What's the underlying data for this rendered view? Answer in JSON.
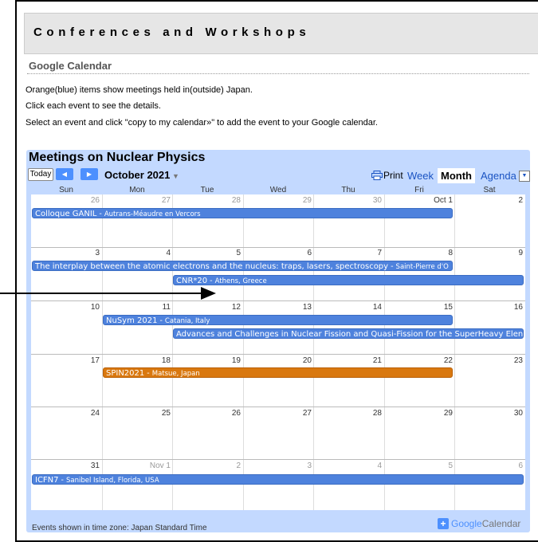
{
  "page": {
    "title": "Conferences and Workshops",
    "section_title": "Google Calendar",
    "info_lines": [
      "Orange(blue) items show meetings held in(outside) Japan.",
      "Click each event to see the details.",
      "Select an event and click \"copy to my calendar»\" to add the event to your Google calendar."
    ]
  },
  "calendar": {
    "title": "Meetings on Nuclear Physics",
    "today_label": "Today",
    "month_label": "October 2021",
    "print_label": "Print",
    "views": [
      "Week",
      "Month",
      "Agenda"
    ],
    "active_view": "Month",
    "weekdays": [
      "Sun",
      "Mon",
      "Tue",
      "Wed",
      "Thu",
      "Fri",
      "Sat"
    ],
    "weeks": [
      [
        "26",
        "27",
        "28",
        "29",
        "30",
        "Oct 1",
        "2"
      ],
      [
        "3",
        "4",
        "5",
        "6",
        "7",
        "8",
        "9"
      ],
      [
        "10",
        "11",
        "12",
        "13",
        "14",
        "15",
        "16"
      ],
      [
        "17",
        "18",
        "19",
        "20",
        "21",
        "22",
        "23"
      ],
      [
        "24",
        "25",
        "26",
        "27",
        "28",
        "29",
        "30"
      ],
      [
        "31",
        "Nov 1",
        "2",
        "3",
        "4",
        "5",
        "6"
      ]
    ],
    "events": [
      {
        "name": "Colloque GANIL",
        "location": "Autrans-Méaudre en Vercors",
        "color": "blue"
      },
      {
        "name": "The interplay between the atomic electrons and the nucleus: traps, lasers, spectroscopy",
        "location": "Saint-Pierre d'O",
        "color": "blue"
      },
      {
        "name": "CNR*20",
        "location": "Athens, Greece",
        "color": "blue"
      },
      {
        "name": "NuSym 2021",
        "location": "Catania, Italy",
        "color": "blue"
      },
      {
        "name": "Advances and Challenges in Nuclear Fission and Quasi-Fission for the SuperHeavy Elen",
        "location": "",
        "color": "blue"
      },
      {
        "name": "SPIN2021",
        "location": "Matsue, Japan",
        "color": "orange"
      },
      {
        "name": "ICFN7",
        "location": "Sanibel Island, Florida, USA",
        "color": "blue"
      }
    ],
    "timezone_note": "Events shown in time zone: Japan Standard Time",
    "badge_google": "Google",
    "badge_calendar": "Calendar",
    "colors": {
      "blue_event": "#4e82dd",
      "orange_event": "#d9780f",
      "header_bg": "#c3d9ff",
      "nav_button": "#4d90fe"
    }
  }
}
